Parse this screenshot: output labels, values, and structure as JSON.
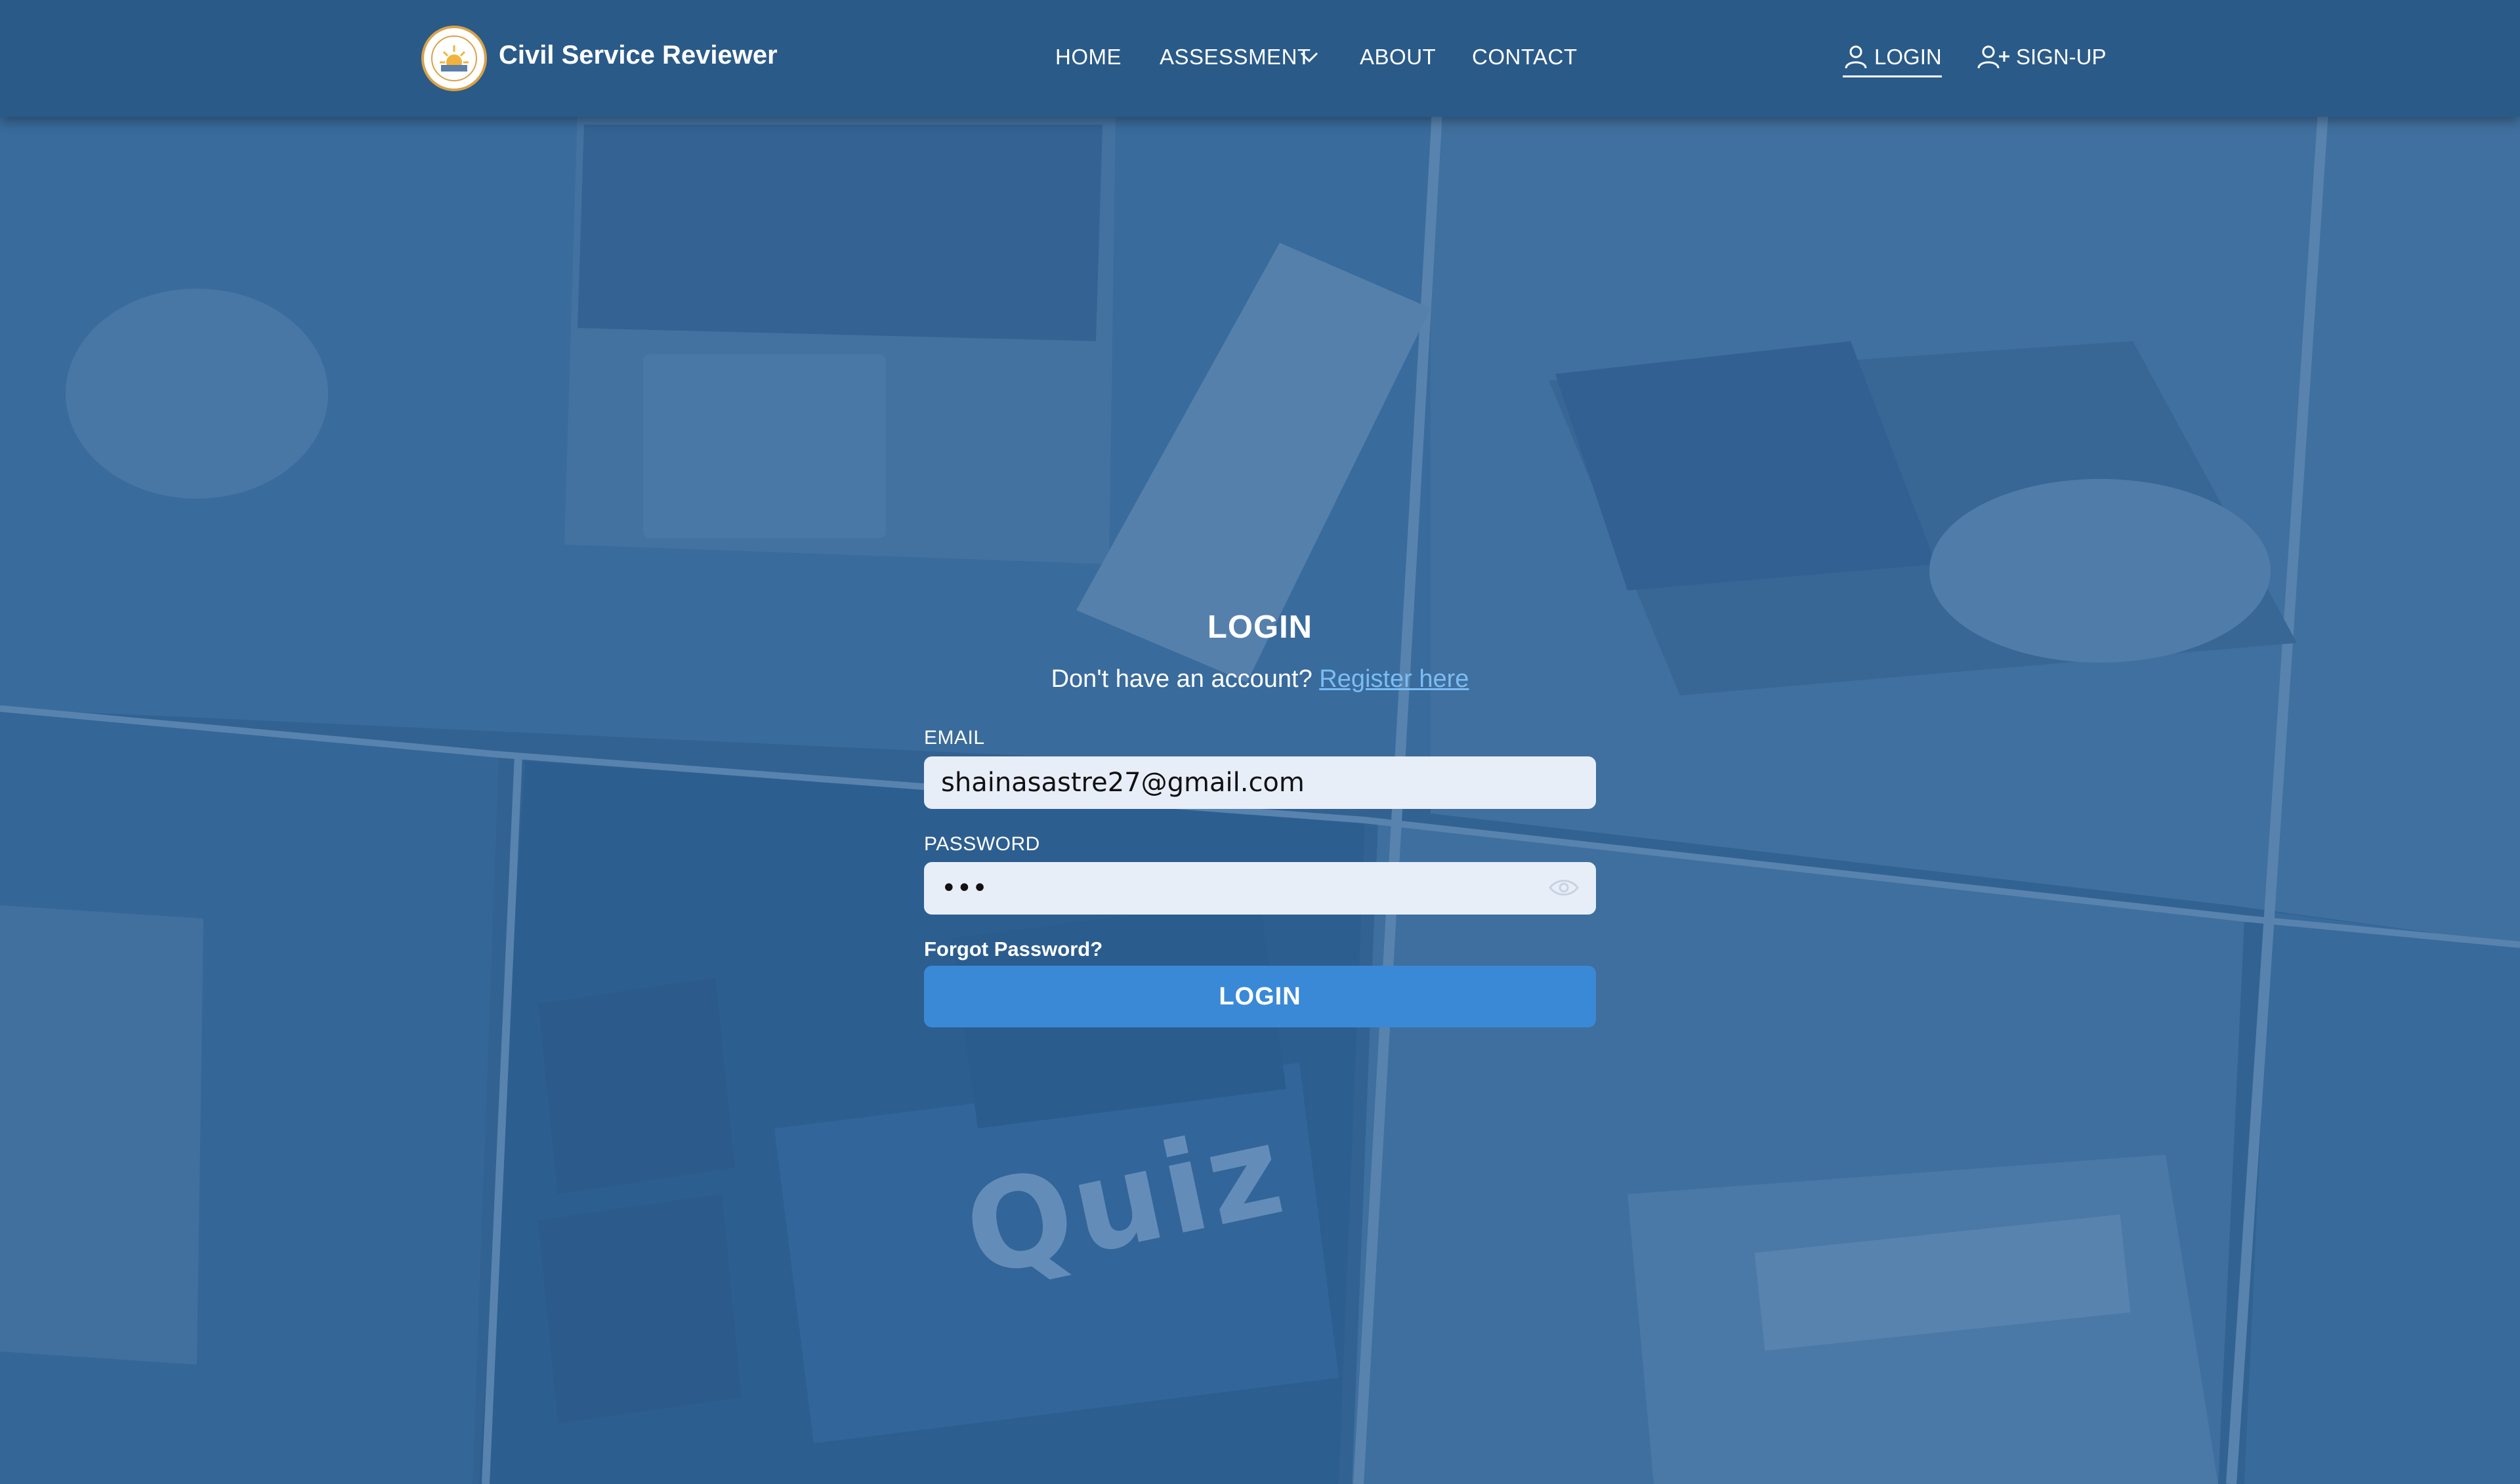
{
  "header": {
    "brand": "Civil Service Reviewer",
    "nav": {
      "home": "HOME",
      "assessment": "ASSESSMENT",
      "about": "ABOUT",
      "contact": "CONTACT"
    },
    "login": "LOGIN",
    "signup": "SIGN-UP"
  },
  "login_form": {
    "title": "LOGIN",
    "subtitle_prefix": "Don't have an account?",
    "register_link": "Register here",
    "email_label": "EMAIL",
    "email_value": "shainasastre27@gmail.com",
    "password_label": "PASSWORD",
    "password_value": "•••",
    "forgot": "Forgot Password?",
    "submit": "LOGIN"
  },
  "background": {
    "quiz_key_text": "Quiz"
  },
  "colors": {
    "header_bg": "#2a5a88",
    "button_bg": "#3a89d6",
    "link": "#7cbcf5",
    "input_bg": "#e8eef8"
  }
}
